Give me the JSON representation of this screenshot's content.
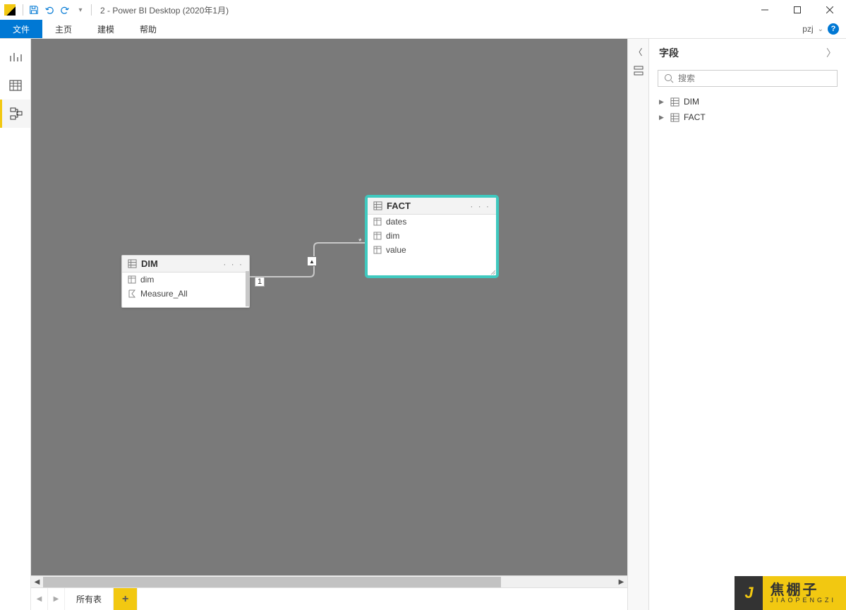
{
  "titlebar": {
    "title": "2 - Power BI Desktop (2020年1月)"
  },
  "ribbon": {
    "tabs": [
      "文件",
      "主页",
      "建模",
      "帮助"
    ],
    "user": "pzj"
  },
  "canvas": {
    "dim_table": {
      "name": "DIM",
      "fields": [
        "dim",
        "Measure_All"
      ]
    },
    "fact_table": {
      "name": "FACT",
      "fields": [
        "dates",
        "dim",
        "value"
      ]
    },
    "relationship": {
      "left_card": "1",
      "right_card": "*"
    }
  },
  "bottom_tabs": {
    "tab1": "所有表"
  },
  "fields_panel": {
    "title": "字段",
    "search_placeholder": "搜索",
    "tables": [
      "DIM",
      "FACT"
    ]
  },
  "watermark": {
    "letter": "J",
    "cn": "焦棚子",
    "en": "JIAOPENGZI"
  }
}
